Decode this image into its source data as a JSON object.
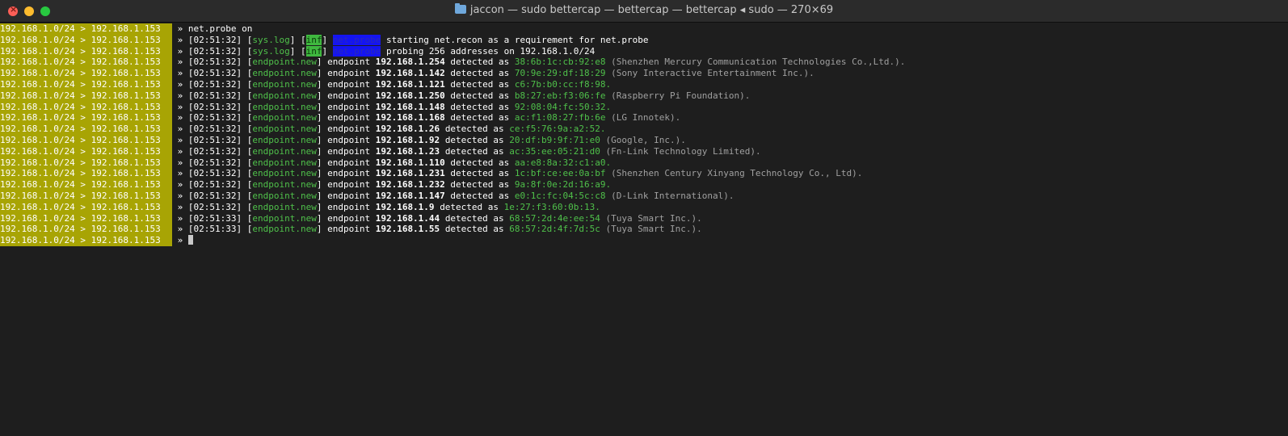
{
  "window": {
    "title": "jaccon — sudo bettercap — bettercap — bettercap ◂ sudo — 270×69"
  },
  "prompt": {
    "subnet": "192.168.1.0/24",
    "arrow": ">",
    "host": "192.168.1.153",
    "chevron": "»"
  },
  "command": "net.probe on",
  "log_lines": [
    {
      "time": "[02:51:32]",
      "tag": "sys.log",
      "level": "inf",
      "module": "net.probe",
      "text": "starting net.recon as a requirement for net.probe"
    },
    {
      "time": "[02:51:32]",
      "tag": "sys.log",
      "level": "inf",
      "module": "net.probe",
      "text": "probing 256 addresses on 192.168.1.0/24"
    }
  ],
  "endpoints": [
    {
      "time": "[02:51:32]",
      "tag": "endpoint.new",
      "ip": "192.168.1.254",
      "mac": "38:6b:1c:cb:92:e8",
      "vendor": "(Shenzhen Mercury Communication Technologies Co.,Ltd.)."
    },
    {
      "time": "[02:51:32]",
      "tag": "endpoint.new",
      "ip": "192.168.1.142",
      "mac": "70:9e:29:df:18:29",
      "vendor": "(Sony Interactive Entertainment Inc.)."
    },
    {
      "time": "[02:51:32]",
      "tag": "endpoint.new",
      "ip": "192.168.1.121",
      "mac": "c6:7b:b0:cc:f8:98.",
      "vendor": ""
    },
    {
      "time": "[02:51:32]",
      "tag": "endpoint.new",
      "ip": "192.168.1.250",
      "mac": "b8:27:eb:f3:06:fe",
      "vendor": "(Raspberry Pi Foundation)."
    },
    {
      "time": "[02:51:32]",
      "tag": "endpoint.new",
      "ip": "192.168.1.148",
      "mac": "92:08:04:fc:50:32.",
      "vendor": ""
    },
    {
      "time": "[02:51:32]",
      "tag": "endpoint.new",
      "ip": "192.168.1.168",
      "mac": "ac:f1:08:27:fb:6e",
      "vendor": "(LG Innotek)."
    },
    {
      "time": "[02:51:32]",
      "tag": "endpoint.new",
      "ip": "192.168.1.26",
      "mac": "ce:f5:76:9a:a2:52.",
      "vendor": ""
    },
    {
      "time": "[02:51:32]",
      "tag": "endpoint.new",
      "ip": "192.168.1.92",
      "mac": "20:df:b9:9f:71:e0",
      "vendor": "(Google, Inc.)."
    },
    {
      "time": "[02:51:32]",
      "tag": "endpoint.new",
      "ip": "192.168.1.23",
      "mac": "ac:35:ee:05:21:d0",
      "vendor": "(Fn-Link Technology Limited)."
    },
    {
      "time": "[02:51:32]",
      "tag": "endpoint.new",
      "ip": "192.168.1.110",
      "mac": "aa:e8:8a:32:c1:a0.",
      "vendor": ""
    },
    {
      "time": "[02:51:32]",
      "tag": "endpoint.new",
      "ip": "192.168.1.231",
      "mac": "1c:bf:ce:ee:0a:bf",
      "vendor": "(Shenzhen Century Xinyang Technology Co., Ltd)."
    },
    {
      "time": "[02:51:32]",
      "tag": "endpoint.new",
      "ip": "192.168.1.232",
      "mac": "9a:8f:0e:2d:16:a9.",
      "vendor": ""
    },
    {
      "time": "[02:51:32]",
      "tag": "endpoint.new",
      "ip": "192.168.1.147",
      "mac": "e0:1c:fc:04:5c:c8",
      "vendor": "(D-Link International)."
    },
    {
      "time": "[02:51:32]",
      "tag": "endpoint.new",
      "ip": "192.168.1.9",
      "mac": "1e:27:f3:60:0b:13.",
      "vendor": ""
    },
    {
      "time": "[02:51:33]",
      "tag": "endpoint.new",
      "ip": "192.168.1.44",
      "mac": "68:57:2d:4e:ee:54",
      "vendor": "(Tuya Smart Inc.)."
    },
    {
      "time": "[02:51:33]",
      "tag": "endpoint.new",
      "ip": "192.168.1.55",
      "mac": "68:57:2d:4f:7d:5c",
      "vendor": "(Tuya Smart Inc.)."
    }
  ],
  "words": {
    "endpoint": "endpoint",
    "detected_as": "detected as"
  },
  "colors": {
    "prompt_bg": "#a8a404",
    "green": "#4fc04a",
    "inf_bg": "#3fb83f",
    "module_bg": "#1414f2",
    "terminal_bg": "#1e1e1e"
  }
}
